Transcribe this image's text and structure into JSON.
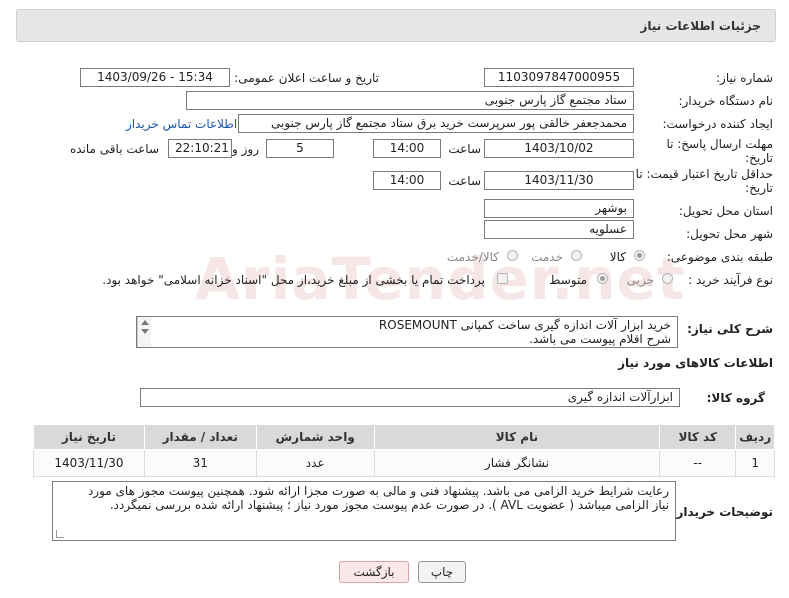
{
  "header": {
    "title": "جزئیات اطلاعات نیاز"
  },
  "watermark": "AriaTender.net",
  "fields": {
    "need_number_label": "شماره نیاز:",
    "need_number": "1103097847000955",
    "announce_label": "تاریخ و ساعت اعلان عمومی:",
    "announce_value": "1403/09/26 - 15:34",
    "buyer_org_label": "نام دستگاه خریدار:",
    "buyer_org": "ستاد مجتمع گاز پارس جنوبی",
    "creator_label": "ایجاد کننده درخواست:",
    "creator": "محمدجعفر خالقی پور سرپرست خرید برق ستاد مجتمع گاز پارس جنوبی",
    "contact_link": "اطلاعات تماس خریدار",
    "deadline_label_1": "مهلت ارسال پاسخ: تا",
    "deadline_label_2": "تاریخ:",
    "deadline_date": "1403/10/02",
    "time_label": "ساعت",
    "deadline_time": "14:00",
    "days_value": "5",
    "days_label": "روز و",
    "remaining_time": "22:10:21",
    "remaining_label": "ساعت باقی مانده",
    "validity_label_1": "حداقل تاریخ اعتبار قیمت: تا",
    "validity_label_2": "تاریخ:",
    "validity_date": "1403/11/30",
    "validity_time": "14:00",
    "province_label": "استان محل تحویل:",
    "province": "بوشهر",
    "city_label": "شهر محل تحویل:",
    "city": "عسلویه",
    "category_label": "طبقه بندی موضوعی:",
    "category_options": [
      "کالا",
      "خدمت",
      "کالا/خدمت"
    ],
    "process_label": "نوع فرآیند خرید :",
    "process_options": [
      "جزیی",
      "متوسط"
    ],
    "payment_note": "پرداخت تمام یا بخشی از مبلغ خرید،از محل \"اسناد خزانه اسلامی\" خواهد بود."
  },
  "description": {
    "label": "شرح کلی نیاز:",
    "line1": "خرید ابزار آلات اندازه گیری ساخت کمپانی ROSEMOUNT",
    "line2": "شرح اقلام پیوست می باشد."
  },
  "goods_section": {
    "title": "اطلاعات کالاهای مورد نیاز",
    "group_label": "گروه کالا:",
    "group_value": "ابزارآلات اندازه گیری"
  },
  "table": {
    "headers": [
      "ردیف",
      "کد کالا",
      "نام کالا",
      "واحد شمارش",
      "تعداد / مقدار",
      "تاریخ نیاز"
    ],
    "rows": [
      [
        "1",
        "--",
        "نشانگر فشار",
        "عدد",
        "31",
        "1403/11/30"
      ]
    ]
  },
  "buyer_notes": {
    "label": "توضیحات خریدار:",
    "text": "رعایت شرایط خرید الزامی می باشد. پیشنهاد فنی و مالی به صورت مجزا ارائه شود. همچنین پیوست مجوز های مورد نیاز الزامی میباشد ( عضویت AVL ).  در صورت عدم پیوست مجوز مورد نیاز ؛ پیشنهاد ارائه شده بررسی نمیگردد."
  },
  "buttons": {
    "print": "چاپ",
    "back": "بازگشت"
  }
}
